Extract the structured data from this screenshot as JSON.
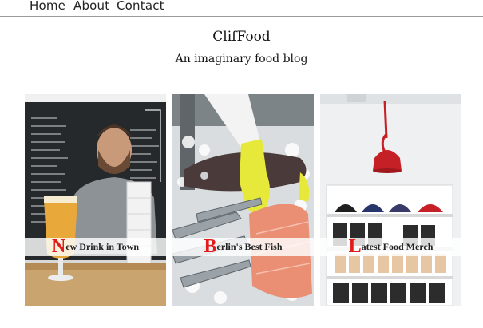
{
  "nav": {
    "items": [
      "Home",
      "About",
      "Contact"
    ]
  },
  "site": {
    "title": "ClifFood",
    "tagline": "An imaginary food blog"
  },
  "posts": [
    {
      "initial": "N",
      "rest": "ew Drink in Town"
    },
    {
      "initial": "B",
      "rest": "erlin's Best Fish"
    },
    {
      "initial": "L",
      "rest": "atest Food Merch"
    }
  ],
  "colors": {
    "accent": "#e21b1b"
  }
}
